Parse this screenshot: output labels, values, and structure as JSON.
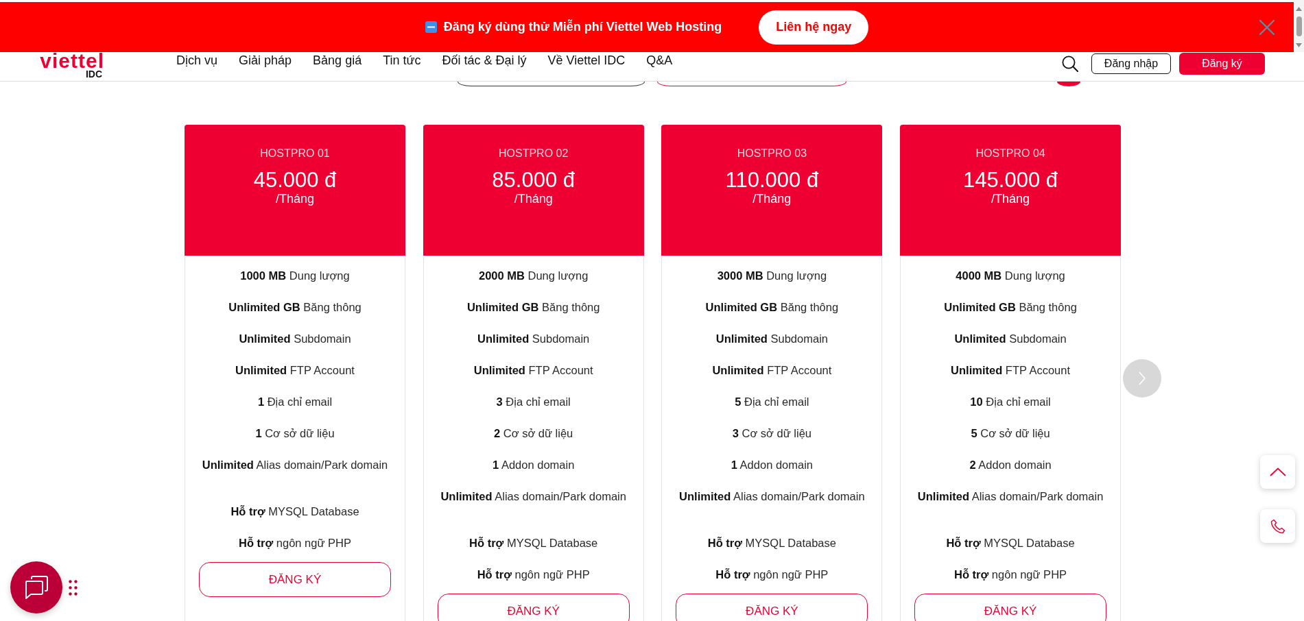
{
  "banner": {
    "text": "Đăng ký dùng thử Miễn phí Viettel Web Hosting",
    "button": "Liên hệ ngay"
  },
  "header": {
    "logo": {
      "wordmark": "viettel",
      "sub": "IDC"
    },
    "nav": [
      "Dịch vụ",
      "Giải pháp",
      "Bảng giá",
      "Tin tức",
      "Đối tác & Đại lý",
      "Về Viettel IDC",
      "Q&A"
    ],
    "login": "Đăng nhập",
    "register": "Đăng ký"
  },
  "plans": [
    {
      "name": "HOSTPRO 01",
      "price": "45.000 đ",
      "period": "/Tháng",
      "features": [
        "**1000 MB** Dung lượng",
        "**Unlimited GB** Băng thông",
        "**Unlimited** Subdomain",
        "**Unlimited** FTP Account",
        "**1** Địa chỉ email",
        "**1** Cơ sở dữ liệu",
        "**Unlimited** Alias domain/Park domain"
      ],
      "support": [
        "**Hỗ trợ** MYSQL Database",
        "**Hỗ trợ** ngôn ngữ PHP"
      ],
      "button": "ĐĂNG KÝ"
    },
    {
      "name": "HOSTPRO 02",
      "price": "85.000 đ",
      "period": "/Tháng",
      "features": [
        "**2000 MB** Dung lượng",
        "**Unlimited GB** Băng thông",
        "**Unlimited** Subdomain",
        "**Unlimited** FTP Account",
        "**3** Địa chỉ email",
        "**2** Cơ sở dữ liệu",
        "**1** Addon domain",
        "**Unlimited** Alias domain/Park domain"
      ],
      "support": [
        "**Hỗ trợ** MYSQL Database",
        "**Hỗ trợ** ngôn ngữ PHP"
      ],
      "button": "ĐĂNG KÝ"
    },
    {
      "name": "HOSTPRO 03",
      "price": "110.000 đ",
      "period": "/Tháng",
      "features": [
        "**3000 MB** Dung lượng",
        "**Unlimited GB** Băng thông",
        "**Unlimited** Subdomain",
        "**Unlimited** FTP Account",
        "**5** Địa chỉ email",
        "**3** Cơ sở dữ liệu",
        "**1** Addon domain",
        "**Unlimited** Alias domain/Park domain"
      ],
      "support": [
        "**Hỗ trợ** MYSQL Database",
        "**Hỗ trợ** ngôn ngữ PHP"
      ],
      "button": "ĐĂNG KÝ"
    },
    {
      "name": "HOSTPRO 04",
      "price": "145.000 đ",
      "period": "/Tháng",
      "features": [
        "**4000 MB** Dung lượng",
        "**Unlimited GB** Băng thông",
        "**Unlimited** Subdomain",
        "**Unlimited** FTP Account",
        "**10** Địa chỉ email",
        "**5** Cơ sở dữ liệu",
        "**2** Addon domain",
        "**Unlimited** Alias domain/Park domain"
      ],
      "support": [
        "**Hỗ trợ** MYSQL Database",
        "**Hỗ trợ** ngôn ngữ PHP"
      ],
      "button": "ĐĂNG KÝ"
    }
  ]
}
